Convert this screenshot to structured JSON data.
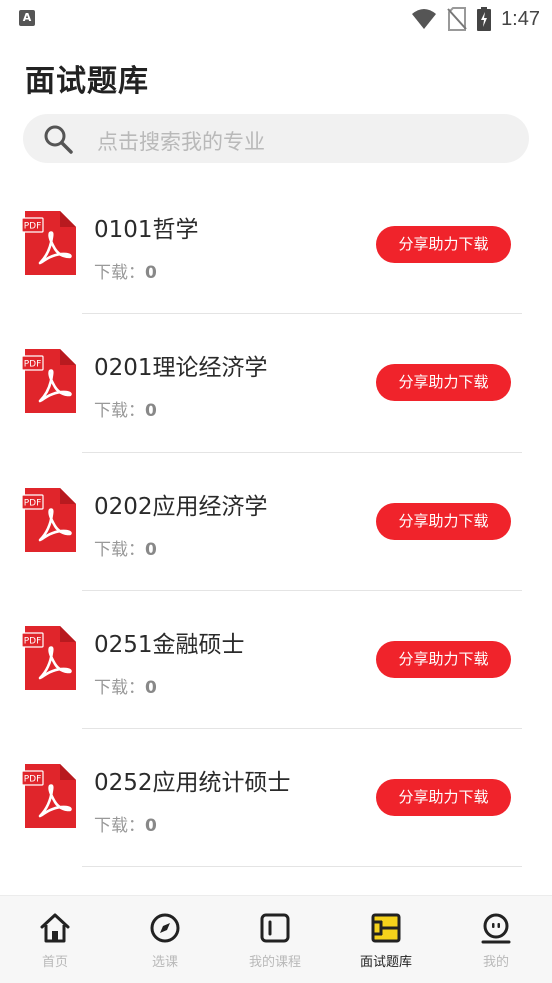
{
  "status_bar": {
    "app_icon_letter": "A",
    "time": "1:47",
    "icons": [
      "wifi-icon",
      "no-sim-icon",
      "battery-charging-icon"
    ]
  },
  "page": {
    "title": "面试题库"
  },
  "search": {
    "placeholder": "点击搜索我的专业",
    "icon": "search-icon"
  },
  "list": {
    "download_label": "下载：",
    "button_label": "分享助力下载",
    "items": [
      {
        "title": "0101哲学",
        "downloads": "0"
      },
      {
        "title": "0201理论经济学",
        "downloads": "0"
      },
      {
        "title": "0202应用经济学",
        "downloads": "0"
      },
      {
        "title": "0251金融硕士",
        "downloads": "0"
      },
      {
        "title": "0252应用统计硕士",
        "downloads": "0"
      }
    ]
  },
  "tab_bar": {
    "tabs": [
      {
        "label": "首页",
        "icon": "home-icon",
        "active": false
      },
      {
        "label": "选课",
        "icon": "compass-icon",
        "active": false
      },
      {
        "label": "我的课程",
        "icon": "course-icon",
        "active": false
      },
      {
        "label": "面试题库",
        "icon": "question-bank-icon",
        "active": true
      },
      {
        "label": "我的",
        "icon": "profile-icon",
        "active": false
      }
    ]
  },
  "colors": {
    "accent": "#f0232b",
    "pdf_red": "#e0252b",
    "tab_active_yellow": "#f5d21b"
  }
}
